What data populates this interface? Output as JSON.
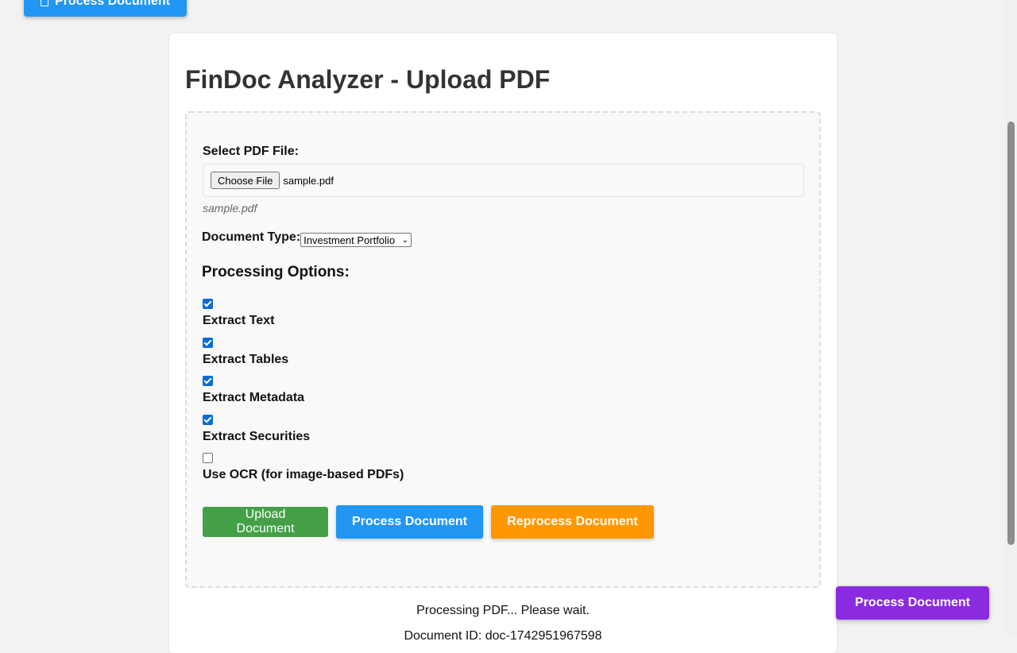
{
  "top_button": {
    "label": "Process Document"
  },
  "card": {
    "title": "FinDoc Analyzer - Upload PDF",
    "file_section": {
      "label": "Select PDF File:",
      "choose_button": "Choose File",
      "selected_file": "sample.pdf",
      "hint": "sample.pdf"
    },
    "doc_type": {
      "label": "Document Type:",
      "selected": "Investment Portfolio"
    },
    "options": {
      "heading": "Processing Options:",
      "items": [
        {
          "label": "Extract Text",
          "checked": true
        },
        {
          "label": "Extract Tables",
          "checked": true
        },
        {
          "label": "Extract Metadata",
          "checked": true
        },
        {
          "label": "Extract Securities",
          "checked": true
        },
        {
          "label": "Use OCR (for image-based PDFs)",
          "checked": false
        }
      ]
    },
    "actions": {
      "upload": "Upload Document",
      "process": "Process Document",
      "reprocess": "Reprocess Document"
    },
    "status": "Processing PDF... Please wait.",
    "document_id": "Document ID: doc-1742951967598"
  },
  "floating_button": {
    "label": "Process Document"
  },
  "colors": {
    "blue": "#2196f3",
    "green": "#43a047",
    "orange": "#ff9800",
    "purple": "#8a2be2"
  }
}
